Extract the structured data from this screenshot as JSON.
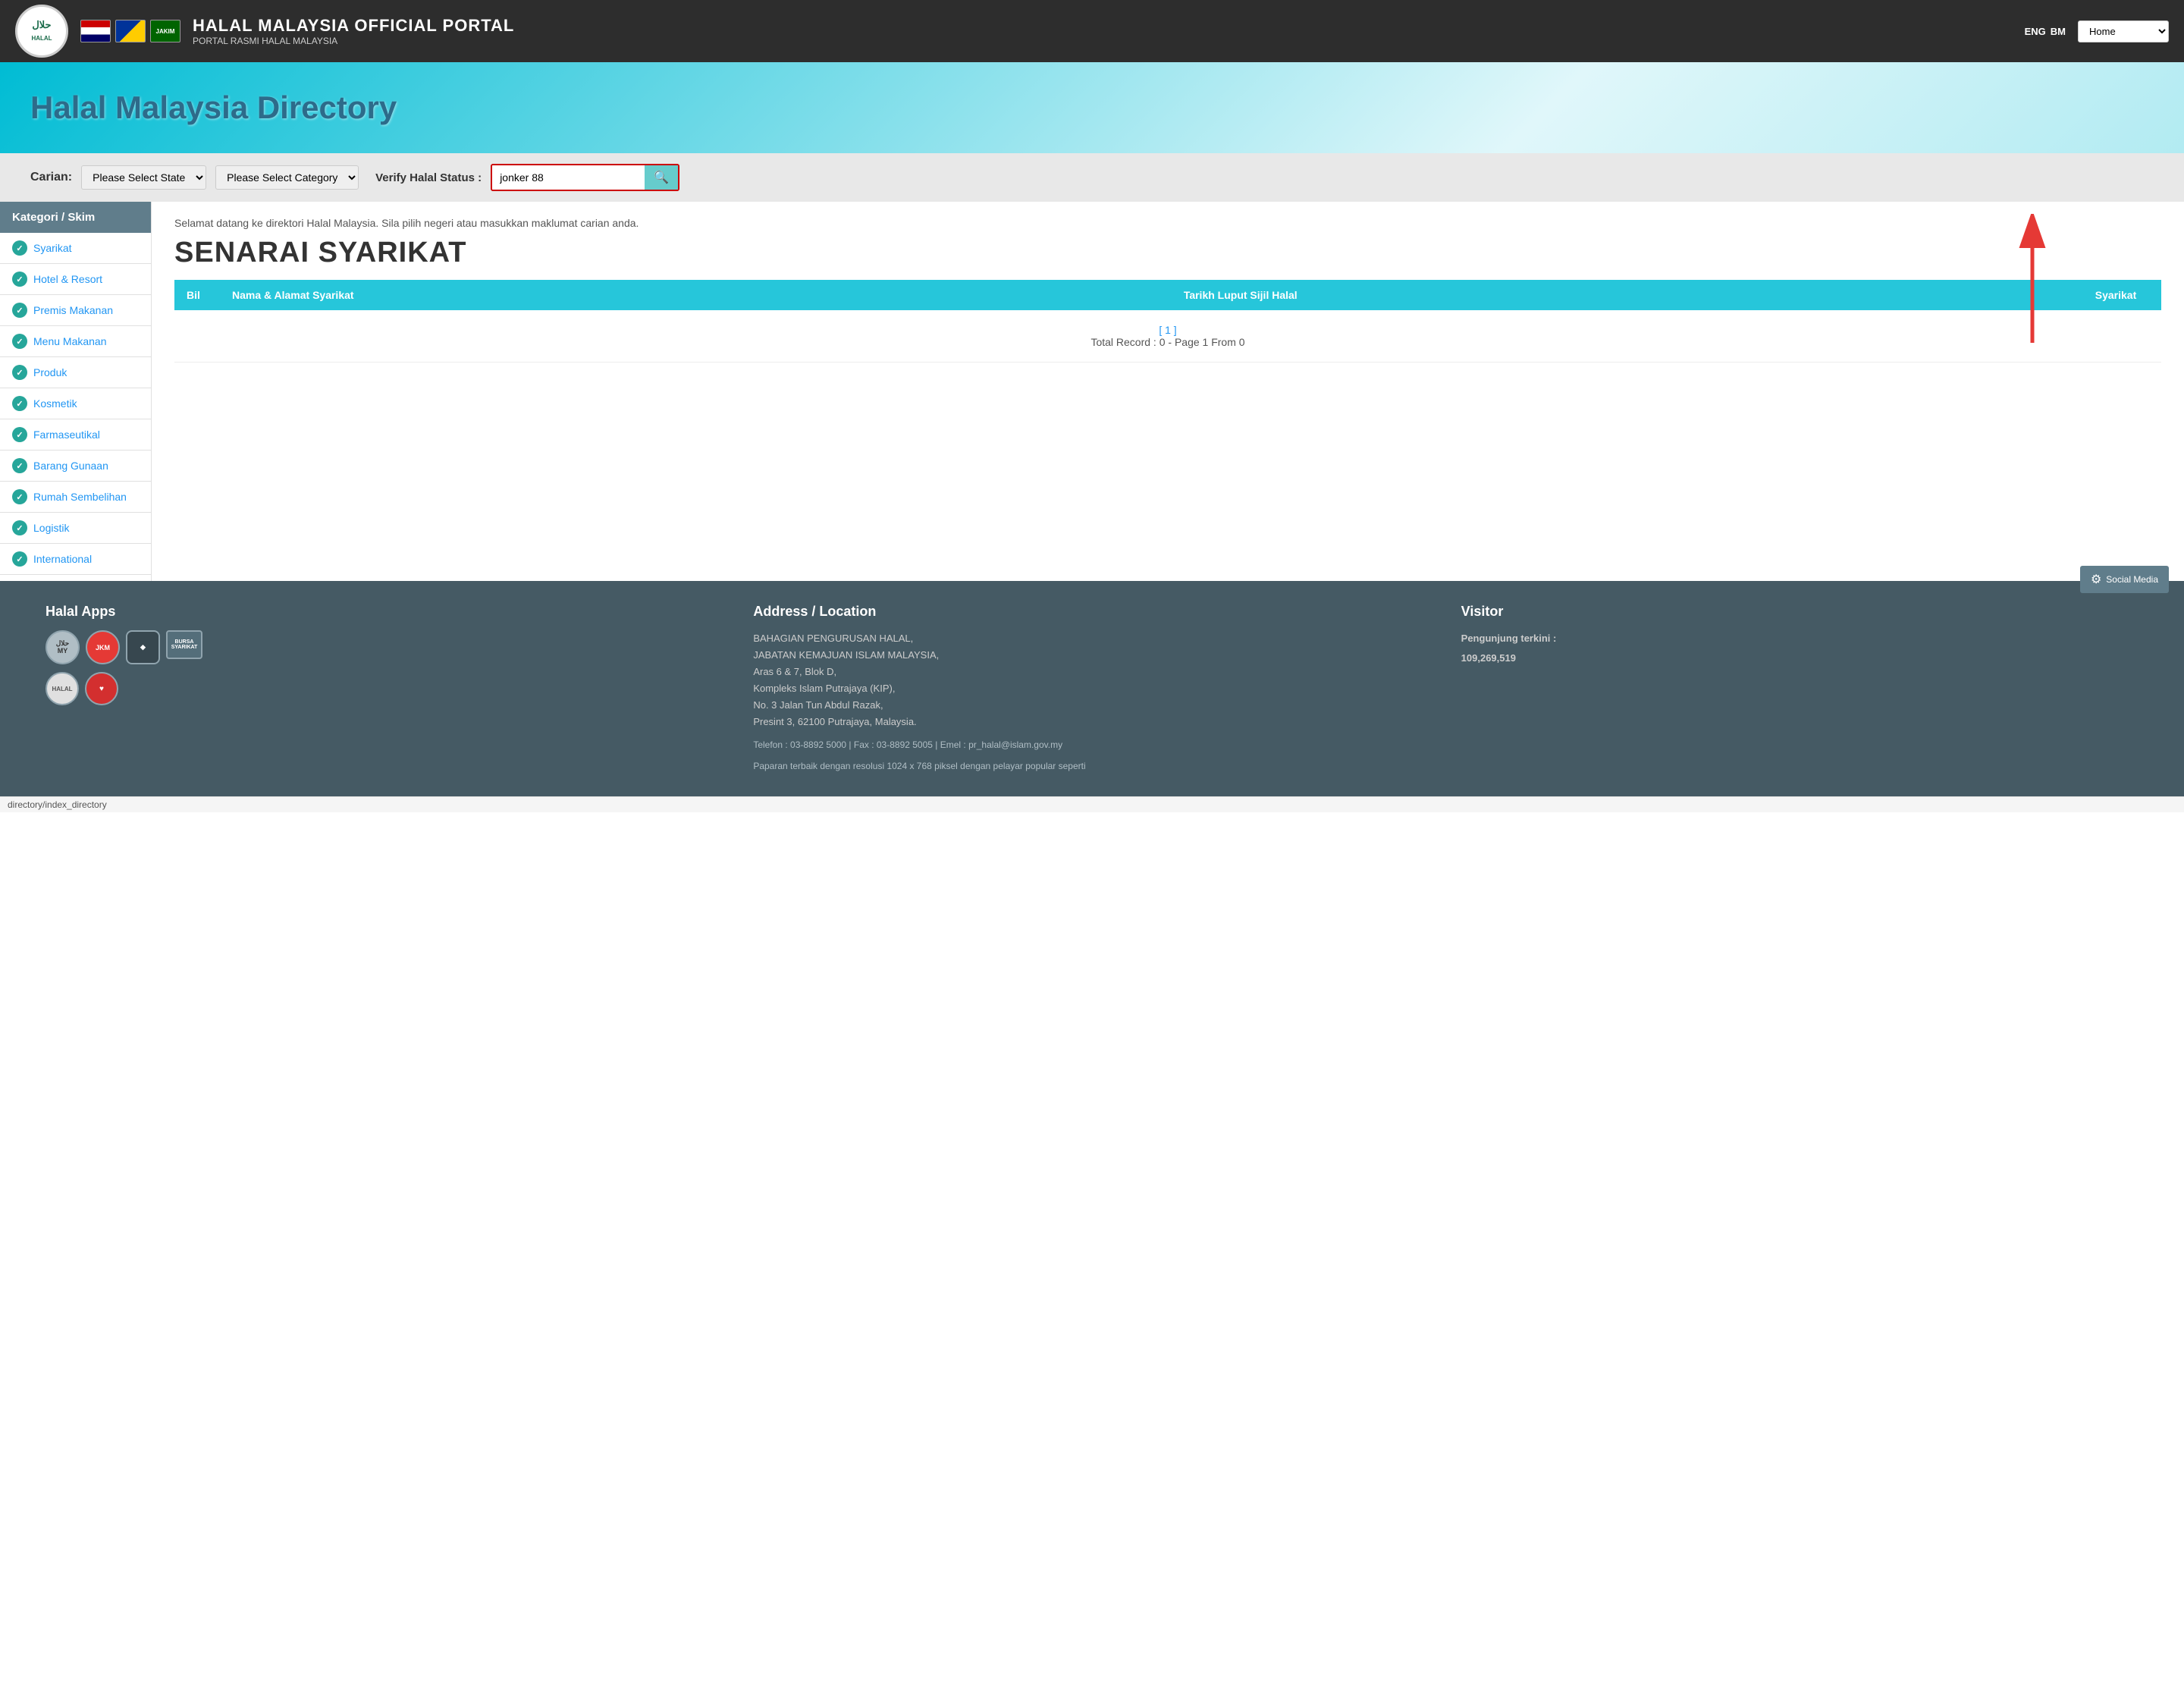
{
  "header": {
    "title": "HALAL MALAYSIA OFFICIAL PORTAL",
    "subtitle": "PORTAL RASMI HALAL MALAYSIA",
    "lang_eng": "ENG",
    "lang_bm": "BM",
    "nav_home": "Home",
    "logo_text": "حلال"
  },
  "banner": {
    "title": "Halal Malaysia Directory"
  },
  "search": {
    "label": "Carian:",
    "state_placeholder": "Please Select State",
    "category_placeholder": "Please Select Category",
    "verify_label": "Verify Halal Status :",
    "verify_value": "jonker 88",
    "search_icon": "🔍"
  },
  "sidebar": {
    "header": "Kategori / Skim",
    "items": [
      {
        "label": "Syarikat"
      },
      {
        "label": "Hotel & Resort"
      },
      {
        "label": "Premis Makanan"
      },
      {
        "label": "Menu Makanan"
      },
      {
        "label": "Produk"
      },
      {
        "label": "Kosmetik"
      },
      {
        "label": "Farmaseutikal"
      },
      {
        "label": "Barang Gunaan"
      },
      {
        "label": "Rumah Sembelihan"
      },
      {
        "label": "Logistik"
      },
      {
        "label": "International"
      }
    ]
  },
  "results": {
    "welcome": "Selamat datang ke direktori Halal Malaysia. Sila pilih negeri atau masukkan maklumat carian anda.",
    "title": "SENARAI SYARIKAT",
    "col_bil": "Bil",
    "col_nama": "Nama & Alamat Syarikat",
    "col_tarikh": "Tarikh Luput Sijil Halal",
    "col_syarikat": "Syarikat",
    "pagination_link": "[ 1 ]",
    "total_record": "Total Record : 0 - Page 1 From 0"
  },
  "footer": {
    "apps_title": "Halal Apps",
    "address_title": "Address / Location",
    "address_lines": [
      "BAHAGIAN PENGURUSAN HALAL,",
      "JABATAN KEMAJUAN ISLAM MALAYSIA,",
      "Aras 6 & 7, Blok D,",
      "Kompleks Islam Putrajaya (KIP),",
      "No. 3 Jalan Tun Abdul Razak,",
      "Presint 3, 62100 Putrajaya, Malaysia."
    ],
    "contact": "Telefon : 03-8892 5000 | Fax : 03-8892 5005 | Emel : pr_halal@islam.gov.my",
    "display": "Paparan terbaik dengan resolusi 1024 x 768 piksel dengan pelayar popular seperti",
    "visitor_title": "Visitor",
    "visitor_label": "Pengunjung terkini :",
    "visitor_count": "109,269,519",
    "social_media": "Social Media"
  },
  "status_bar": {
    "url": "directory/index_directory"
  }
}
